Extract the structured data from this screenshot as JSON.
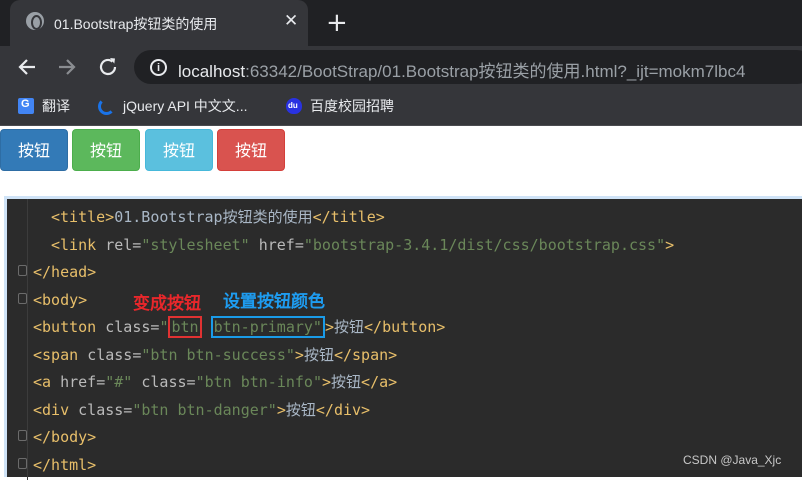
{
  "browser": {
    "tab_title": "01.Bootstrap按钮类的使用",
    "close_glyph": "✕",
    "new_tab_glyph": "+",
    "url_host": "localhost",
    "url_rest": ":63342/BootStrap/01.Bootstrap按钮类的使用.html?_ijt=mokm7lbc4",
    "bookmarks": [
      "翻译",
      "jQuery API 中文文...",
      "百度校园招聘"
    ],
    "icons": {
      "back": "arrow-left",
      "forward": "arrow-right",
      "reload": "reload",
      "info": "info-circle"
    }
  },
  "page": {
    "buttons": [
      {
        "label": "按钮",
        "variant": "primary",
        "color": "#337ab7"
      },
      {
        "label": "按钮",
        "variant": "success",
        "color": "#5cb85c"
      },
      {
        "label": "按钮",
        "variant": "info",
        "color": "#5bc0de"
      },
      {
        "label": "按钮",
        "variant": "danger",
        "color": "#d9534f"
      }
    ]
  },
  "code": {
    "line1": {
      "open": "<title>",
      "text": "01.Bootstrap按钮类的使用",
      "close": "</title>"
    },
    "line2": {
      "open": "<link ",
      "attr1": "rel=",
      "val1": "\"stylesheet\"",
      "attr2": " href=",
      "val2": "\"bootstrap-3.4.1/dist/css/bootstrap.css\"",
      "close": ">"
    },
    "line3": "</head>",
    "line4": "<body>",
    "line5": {
      "open": "<button ",
      "attr": "class=",
      "q1": "\"",
      "btn": "btn",
      "sp": " ",
      "primary": "btn-primary\"",
      "gt": ">",
      "text": "按钮",
      "close": "</button>"
    },
    "line6": {
      "open": "<span ",
      "attr": "class=",
      "val": "\"btn btn-success\"",
      "gt": ">",
      "text": "按钮",
      "close": "</span>"
    },
    "line7": {
      "open": "<a ",
      "attr1": "href=",
      "val1": "\"#\"",
      "attr2": " class=",
      "val2": "\"btn btn-info\"",
      "gt": ">",
      "text": "按钮",
      "close": "</a>"
    },
    "line8": {
      "open": "<div ",
      "attr": "class=",
      "val": "\"btn btn-danger\"",
      "gt": ">",
      "text": "按钮",
      "close": "</div>"
    },
    "line9": "</body>",
    "line10": "</html>"
  },
  "annotations": {
    "red": "变成按钮",
    "blue": "设置按钮颜色",
    "red_color": "#e8272b",
    "blue_color": "#1e9cf0"
  },
  "watermark": "CSDN @Java_Xjc"
}
